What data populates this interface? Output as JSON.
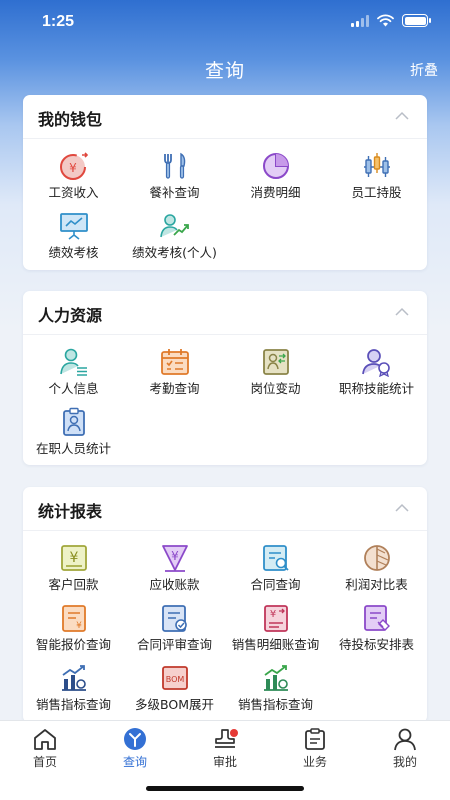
{
  "status": {
    "time": "1:25"
  },
  "nav": {
    "title": "查询",
    "fold": "折叠"
  },
  "wallet": {
    "title": "我的钱包",
    "items": [
      {
        "label": "工资收入",
        "icon": "salary-icon"
      },
      {
        "label": "餐补查询",
        "icon": "cutlery-icon"
      },
      {
        "label": "消费明细",
        "icon": "pie-icon"
      },
      {
        "label": "员工持股",
        "icon": "stock-candles-icon"
      },
      {
        "label": "绩效考核",
        "icon": "presentation-icon"
      },
      {
        "label": "绩效考核(个人)",
        "icon": "person-trend-icon"
      }
    ]
  },
  "hr": {
    "title": "人力资源",
    "items": [
      {
        "label": "个人信息",
        "icon": "person-info-icon"
      },
      {
        "label": "考勤查询",
        "icon": "calendar-icon"
      },
      {
        "label": "岗位变动",
        "icon": "position-change-icon"
      },
      {
        "label": "职称技能统计",
        "icon": "person-badge-icon"
      },
      {
        "label": "在职人员统计",
        "icon": "staff-badge-icon"
      }
    ]
  },
  "reports": {
    "title": "统计报表",
    "items": [
      {
        "label": "客户回款",
        "icon": "yuan-doc-icon"
      },
      {
        "label": "应收账款",
        "icon": "yuan-download-icon"
      },
      {
        "label": "合同查询",
        "icon": "contract-search-icon"
      },
      {
        "label": "利润对比表",
        "icon": "profit-compare-icon"
      },
      {
        "label": "智能报价查询",
        "icon": "quote-doc-icon"
      },
      {
        "label": "合同评审查询",
        "icon": "contract-review-icon"
      },
      {
        "label": "销售明细账查询",
        "icon": "sales-detail-icon"
      },
      {
        "label": "待投标安排表",
        "icon": "bid-schedule-icon"
      },
      {
        "label": "销售指标查询",
        "icon": "sales-index-icon"
      },
      {
        "label": "多级BOM展开",
        "icon": "bom-icon"
      },
      {
        "label": "销售指标查询",
        "icon": "sales-index-gear-icon"
      }
    ]
  },
  "tabs": [
    {
      "label": "首页",
      "icon": "home-icon"
    },
    {
      "label": "查询",
      "icon": "query-icon",
      "active": true
    },
    {
      "label": "审批",
      "icon": "approve-stamp-icon",
      "badge": true
    },
    {
      "label": "业务",
      "icon": "clipboard-icon"
    },
    {
      "label": "我的",
      "icon": "profile-icon"
    }
  ],
  "colors": {
    "accent": "#3370d4",
    "red": "#e0483e",
    "orange": "#e07a2a",
    "purple": "#8b49c9",
    "teal": "#2aa6a0",
    "green": "#3aa64b"
  }
}
